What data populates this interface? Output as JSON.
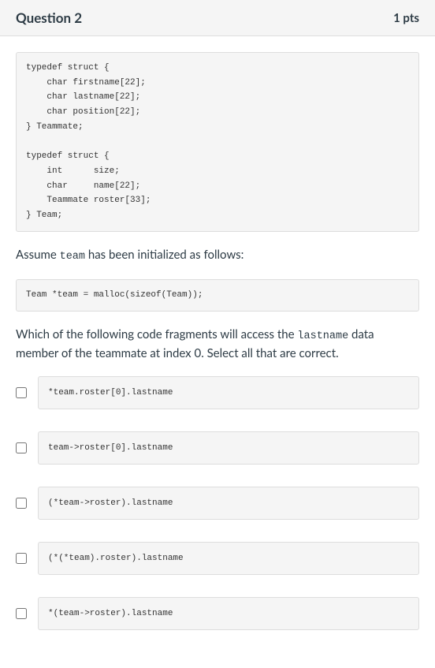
{
  "header": {
    "title": "Question 2",
    "points": "1 pts"
  },
  "code1": "typedef struct {\n    char firstname[22];\n    char lastname[22];\n    char position[22];\n} Teammate;\n\ntypedef struct {\n    int      size;\n    char     name[22];\n    Teammate roster[33];\n} Team;",
  "prose1_pre": "Assume ",
  "prose1_code": "team",
  "prose1_post": " has been initialized as follows:",
  "code2": "Team *team = malloc(sizeof(Team));",
  "prose2_pre": "Which of the following code fragments will access the ",
  "prose2_code": "lastname",
  "prose2_post": " data member of the teammate at index 0. Select all that are correct.",
  "answers": [
    "*team.roster[0].lastname",
    "team->roster[0].lastname",
    "(*team->roster).lastname",
    "(*(*team).roster).lastname",
    "*(team->roster).lastname"
  ]
}
